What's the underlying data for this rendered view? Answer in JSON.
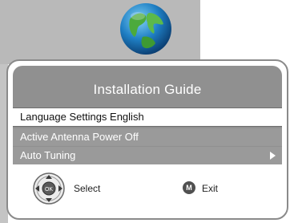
{
  "dialog": {
    "title": "Installation Guide"
  },
  "menu": {
    "items": [
      {
        "label": "Language Settings English"
      },
      {
        "label": "Active Antenna Power Off"
      },
      {
        "label": "Auto Tuning"
      }
    ]
  },
  "footer": {
    "select_label": "Select",
    "exit_key": "M",
    "exit_label": "Exit"
  },
  "icons": {
    "globe": "globe-icon",
    "nav": "navigation-pad-icon",
    "arrow": "arrow-right-icon",
    "menu_key": "menu-key-icon"
  },
  "colors": {
    "header_bg": "#909090",
    "item_bg": "#9a9a9a",
    "selected_bg": "#ffffff",
    "frame": "#8a8a8a"
  }
}
